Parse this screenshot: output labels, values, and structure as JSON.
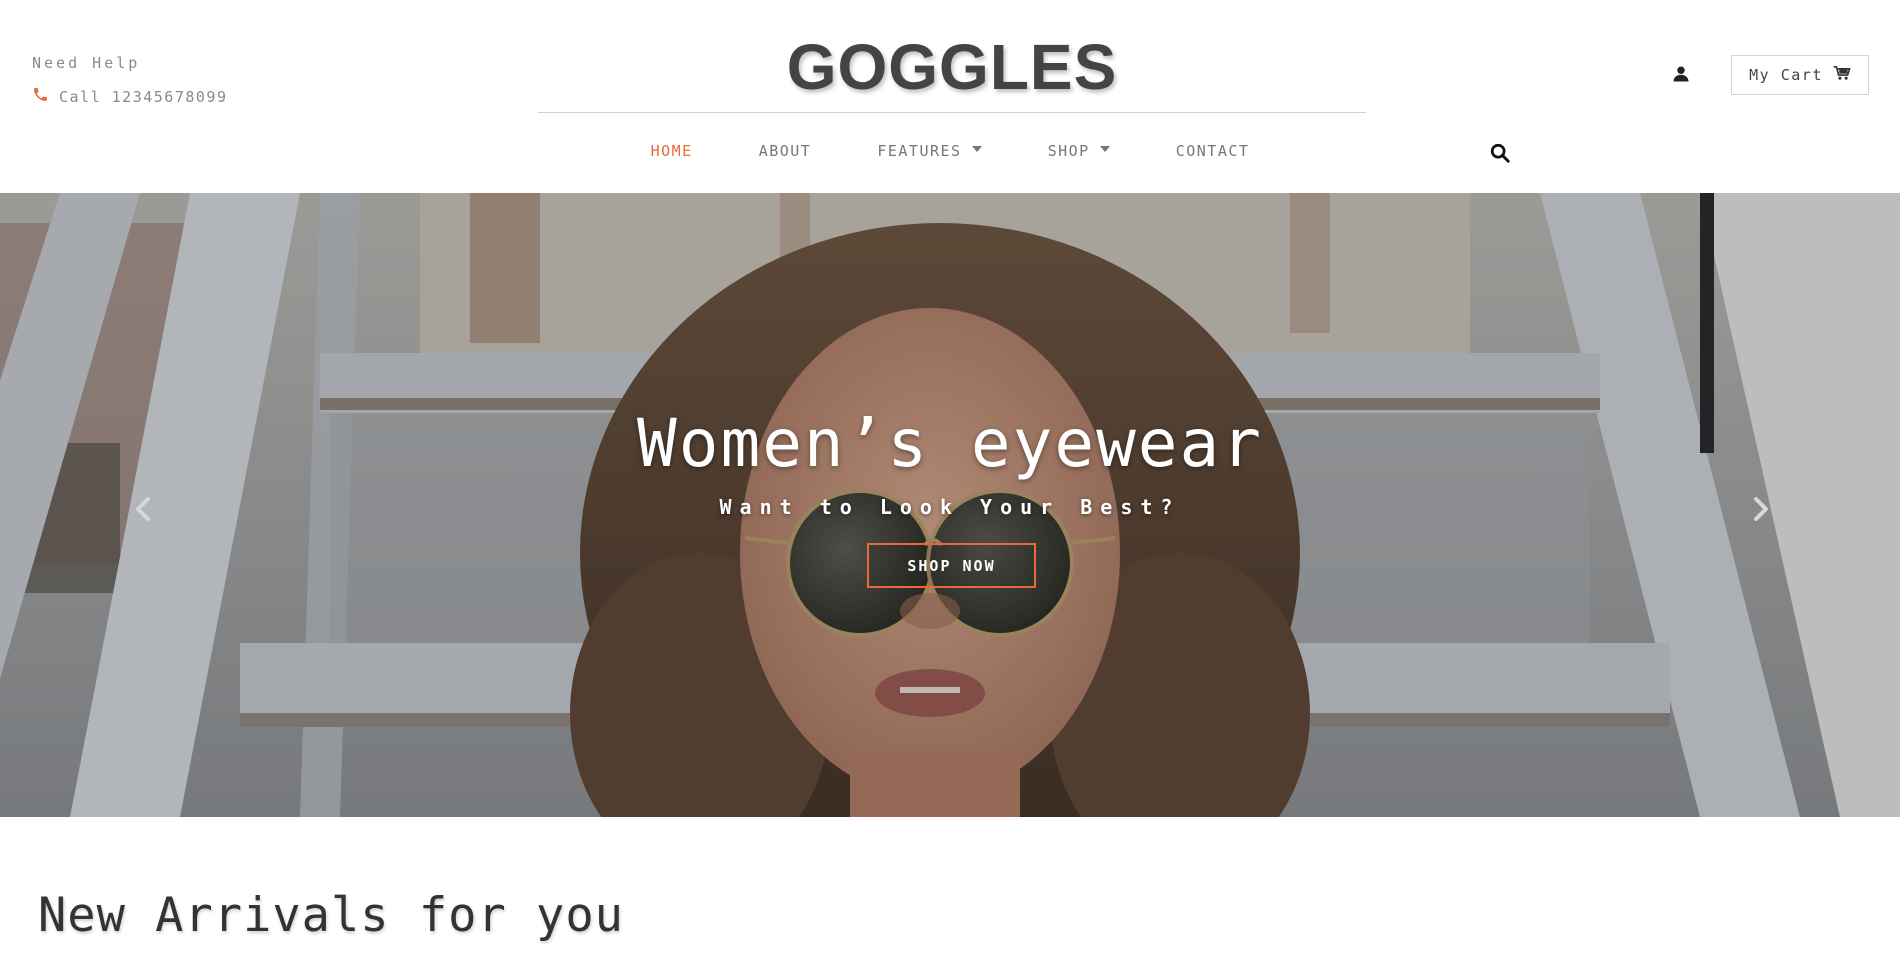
{
  "header": {
    "help_title": "Need Help",
    "help_phone": "Call 12345678099",
    "brand": "GOGGLES",
    "cart_label": "My Cart",
    "accent_color": "#e8683a"
  },
  "nav": {
    "items": [
      {
        "label": "HOME",
        "active": true,
        "dropdown": false
      },
      {
        "label": "ABOUT",
        "active": false,
        "dropdown": false
      },
      {
        "label": "FEATURES",
        "active": false,
        "dropdown": true
      },
      {
        "label": "SHOP",
        "active": false,
        "dropdown": true
      },
      {
        "label": "CONTACT",
        "active": false,
        "dropdown": false
      }
    ]
  },
  "icons": {
    "phone": "phone-icon",
    "search": "search-icon",
    "user": "user-icon",
    "cart": "cart-icon",
    "prev": "chevron-left-icon",
    "next": "chevron-right-icon"
  },
  "hero": {
    "title": "Women’s eyewear",
    "subtitle": "Want to Look Your Best?",
    "cta_label": "SHOP NOW"
  },
  "section": {
    "title": "New Arrivals for you"
  }
}
